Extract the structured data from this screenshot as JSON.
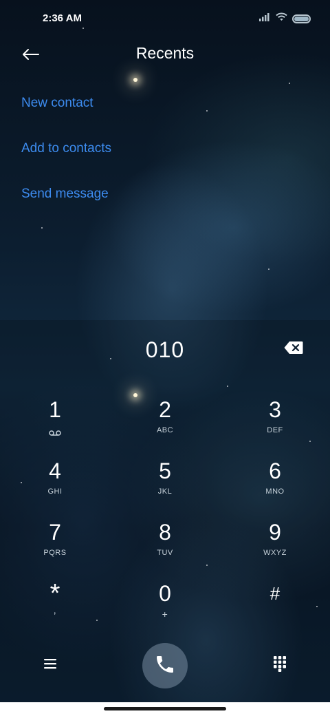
{
  "status_bar": {
    "time": "2:36 AM",
    "icons": [
      "signal-icon",
      "wifi-icon",
      "battery-icon"
    ],
    "battery_level": 1.0
  },
  "header": {
    "back_icon": "back-arrow-icon",
    "title": "Recents"
  },
  "actions": [
    {
      "label": "New contact"
    },
    {
      "label": "Add to contacts"
    },
    {
      "label": "Send message"
    }
  ],
  "dialer": {
    "number": "010",
    "backspace_icon": "backspace-icon",
    "keys": [
      {
        "digit": "1",
        "letters": "",
        "icon": "voicemail-icon"
      },
      {
        "digit": "2",
        "letters": "ABC"
      },
      {
        "digit": "3",
        "letters": "DEF"
      },
      {
        "digit": "4",
        "letters": "GHI"
      },
      {
        "digit": "5",
        "letters": "JKL"
      },
      {
        "digit": "6",
        "letters": "MNO"
      },
      {
        "digit": "7",
        "letters": "PQRS"
      },
      {
        "digit": "8",
        "letters": "TUV"
      },
      {
        "digit": "9",
        "letters": "WXYZ"
      },
      {
        "digit": "*",
        "letters": ","
      },
      {
        "digit": "0",
        "letters": "+"
      },
      {
        "digit": "#",
        "letters": ""
      }
    ]
  },
  "bottom_bar": {
    "menu_icon": "menu-icon",
    "call_icon": "phone-icon",
    "keypad_icon": "dialpad-icon"
  },
  "colors": {
    "link": "#3d8cf0",
    "text": "#ffffff",
    "call_button": "#6f8aa0"
  }
}
